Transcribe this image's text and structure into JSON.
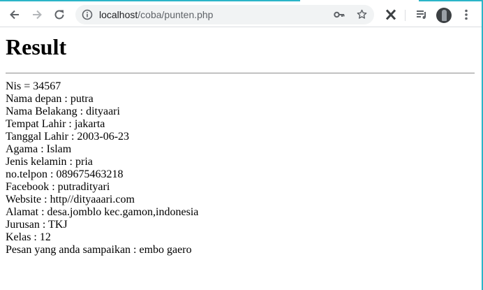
{
  "browser": {
    "url_host": "localhost",
    "url_path": "/coba/punten.php",
    "icons": [
      "back-arrow-icon",
      "forward-arrow-icon",
      "reload-icon",
      "info-icon",
      "key-icon",
      "star-icon",
      "extension-x-icon",
      "media-queue-icon",
      "avatar",
      "kebab-menu-icon"
    ]
  },
  "page": {
    "title": "Result",
    "lines": [
      "Nis = 34567",
      "Nama depan : putra",
      "Nama Belakang : dityaari",
      "Tempat Lahir : jakarta",
      "Tanggal Lahir : 2003-06-23",
      "Agama : Islam",
      "Jenis kelamin : pria",
      "no.telpon : 089675463218",
      "Facebook : putradityari",
      "Website : http//dityaaari.com",
      "Alamat : desa.jomblo kec.gamon,indonesia",
      "Jurusan : TKJ",
      "Kelas : 12",
      "Pesan yang anda sampaikan : embo gaero"
    ]
  },
  "colors": {
    "accent": "#2bb5c8",
    "omnibox_bg": "#f1f3f4",
    "icon": "#5f6368"
  }
}
